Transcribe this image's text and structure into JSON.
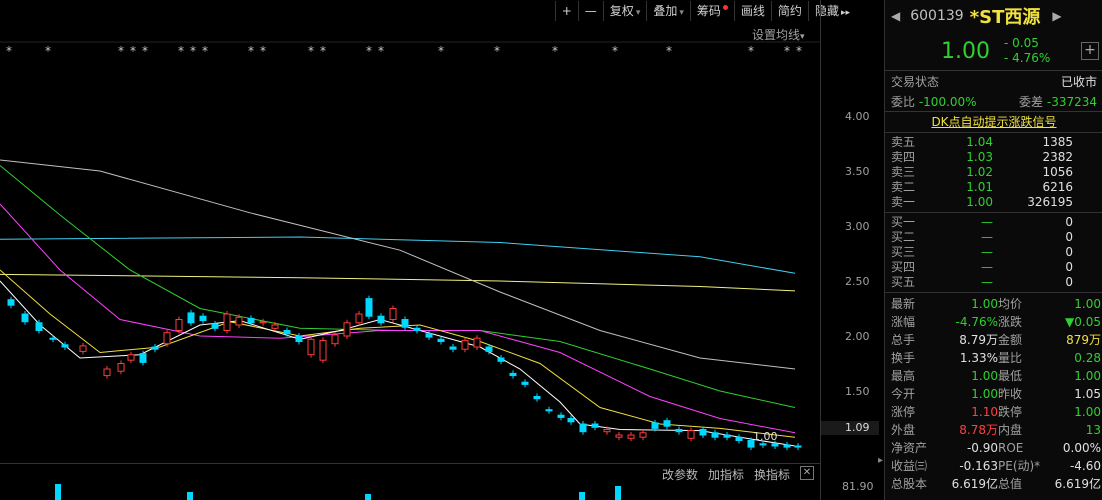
{
  "toolbar": {
    "plus": "+",
    "minus": "—",
    "fuquan": "复权",
    "diejia": "叠加",
    "chouma": "筹码",
    "huaxian": "画线",
    "jianyue": "简约",
    "yincang": "隐藏",
    "more": "▸▸"
  },
  "chart": {
    "setting_ma": "设置均线",
    "price_ticks": [
      "4.00",
      "3.50",
      "3.00",
      "2.50",
      "2.00",
      "1.50"
    ],
    "current_price": "1.09",
    "last_label": "1.00",
    "volume_tick": "81.90",
    "bottom_links": [
      "改参数",
      "加指标",
      "换指标"
    ],
    "colors": {
      "up": "#ff3a3a",
      "down": "#00d8ff",
      "ma5": "#ffffff",
      "ma10": "#f0e040",
      "ma20": "#ff40ff",
      "ma30": "#30d030",
      "ma60": "#c0c0c0",
      "ma120": "#40d0f0",
      "ma250": "#f0f080"
    }
  },
  "stock": {
    "code": "600139",
    "name": "*ST西源",
    "price": "1.00",
    "change": "- 0.05",
    "change_pct": "- 4.76%"
  },
  "status": {
    "label": "交易状态",
    "value": "已收市",
    "weibi_label": "委比",
    "weibi_value": "-100.00%",
    "weicha_label": "委差",
    "weicha_value": "-337234",
    "dk_signal": "DK点自动提示涨跌信号"
  },
  "orderbook": {
    "asks": [
      {
        "label": "卖五",
        "price": "1.04",
        "vol": "1385"
      },
      {
        "label": "卖四",
        "price": "1.03",
        "vol": "2382"
      },
      {
        "label": "卖三",
        "price": "1.02",
        "vol": "1056"
      },
      {
        "label": "卖二",
        "price": "1.01",
        "vol": "6216"
      },
      {
        "label": "卖一",
        "price": "1.00",
        "vol": "326195"
      }
    ],
    "bids": [
      {
        "label": "买一",
        "price": "—",
        "vol": "0"
      },
      {
        "label": "买二",
        "price": "—",
        "vol": "0"
      },
      {
        "label": "买三",
        "price": "—",
        "vol": "0"
      },
      {
        "label": "买四",
        "price": "—",
        "vol": "0"
      },
      {
        "label": "买五",
        "price": "—",
        "vol": "0"
      }
    ]
  },
  "stats": [
    {
      "l1": "最新",
      "v1": "1.00",
      "c1": "grn",
      "l2": "均价",
      "v2": "1.00",
      "c2": "grn"
    },
    {
      "l1": "涨幅",
      "v1": "-4.76%",
      "c1": "grn",
      "l2": "涨跌",
      "v2": "▼0.05",
      "c2": "grn"
    },
    {
      "l1": "总手",
      "v1": "8.79万",
      "c1": "wht",
      "l2": "金额",
      "v2": "879万",
      "c2": "yel"
    },
    {
      "l1": "换手",
      "v1": "1.33%",
      "c1": "wht",
      "l2": "量比",
      "v2": "0.28",
      "c2": "grn"
    },
    {
      "l1": "最高",
      "v1": "1.00",
      "c1": "grn",
      "l2": "最低",
      "v2": "1.00",
      "c2": "grn"
    },
    {
      "l1": "今开",
      "v1": "1.00",
      "c1": "grn",
      "l2": "昨收",
      "v2": "1.05",
      "c2": "wht"
    },
    {
      "l1": "涨停",
      "v1": "1.10",
      "c1": "red",
      "l2": "跌停",
      "v2": "1.00",
      "c2": "grn"
    },
    {
      "l1": "外盘",
      "v1": "8.78万",
      "c1": "red",
      "l2": "内盘",
      "v2": "13",
      "c2": "grn"
    },
    {
      "l1": "净资产",
      "v1": "-0.90",
      "c1": "wht",
      "l2": "ROE",
      "v2": "0.00%",
      "c2": "wht"
    },
    {
      "l1": "收益㈢",
      "v1": "-0.163",
      "c1": "wht",
      "l2": "PE(动)*",
      "v2": "-4.60",
      "c2": "wht"
    },
    {
      "l1": "总股本",
      "v1": "6.619亿",
      "c1": "wht",
      "l2": "总值",
      "v2": "6.619亿",
      "c2": "wht"
    }
  ]
}
